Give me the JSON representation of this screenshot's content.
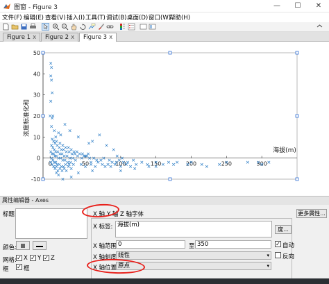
{
  "window": {
    "title": "图窗 - Figure 3",
    "minimize_glyph": "—",
    "maximize_glyph": "☐",
    "close_glyph": "✕"
  },
  "menu": [
    "文件(F)",
    "编辑(E)",
    "查看(V)",
    "插入(I)",
    "工具(T)",
    "调试(B)",
    "桌面(D)",
    "窗口(W)",
    "帮助(H)"
  ],
  "toolbar_icons": [
    "new-file-icon",
    "open-folder-icon",
    "save-icon",
    "print-icon",
    "arrow-cursor-icon",
    "zoom-in-icon",
    "zoom-out-icon",
    "pan-hand-icon",
    "rotate-icon",
    "data-cursor-icon",
    "brush-icon",
    "link-icon",
    "colorbar-icon",
    "legend-icon",
    "hide-plot-tools-icon",
    "show-plot-tools-icon",
    "dock-icon"
  ],
  "tabs": [
    {
      "label": "Figure 1",
      "active": false
    },
    {
      "label": "Figure 2",
      "active": false
    },
    {
      "label": "Figure 3",
      "active": true
    }
  ],
  "tab_close": "x",
  "chart_data": {
    "type": "scatter",
    "marker": "x",
    "color": "#2f7fc7",
    "xlabel": "海拔(m)",
    "ylabel": "浓度标准化和",
    "xlim": [
      -10,
      350
    ],
    "ylim": [
      -10,
      50
    ],
    "yaxis_location": "left",
    "xaxis_location": "origin",
    "xticks": [
      0,
      50,
      100,
      150,
      200,
      250,
      300
    ],
    "yticks": [
      -10,
      0,
      10,
      20,
      30,
      40,
      50
    ],
    "grid": false,
    "points": [
      [
        1,
        45
      ],
      [
        2,
        43
      ],
      [
        1,
        39
      ],
      [
        2,
        37
      ],
      [
        3,
        31
      ],
      [
        1,
        27
      ],
      [
        0,
        20
      ],
      [
        4,
        20
      ],
      [
        3,
        19
      ],
      [
        2,
        15
      ],
      [
        21,
        16
      ],
      [
        28,
        13
      ],
      [
        70,
        11
      ],
      [
        6,
        13
      ],
      [
        12,
        12
      ],
      [
        15,
        11
      ],
      [
        8,
        10
      ],
      [
        40,
        10
      ],
      [
        60,
        8
      ],
      [
        55,
        7
      ],
      [
        80,
        6
      ],
      [
        90,
        4
      ],
      [
        9,
        8
      ],
      [
        14,
        7
      ],
      [
        18,
        6
      ],
      [
        22,
        5
      ],
      [
        26,
        5
      ],
      [
        30,
        4
      ],
      [
        34,
        3
      ],
      [
        38,
        3
      ],
      [
        42,
        2
      ],
      [
        46,
        2
      ],
      [
        48,
        1
      ],
      [
        52,
        1
      ],
      [
        56,
        0
      ],
      [
        62,
        0
      ],
      [
        66,
        -1
      ],
      [
        72,
        -1
      ],
      [
        76,
        0
      ],
      [
        84,
        -1
      ],
      [
        88,
        -2
      ],
      [
        94,
        -2
      ],
      [
        98,
        -1
      ],
      [
        104,
        -2
      ],
      [
        110,
        -2
      ],
      [
        118,
        -1
      ],
      [
        3,
        9
      ],
      [
        5,
        8
      ],
      [
        7,
        7
      ],
      [
        10,
        6
      ],
      [
        13,
        5
      ],
      [
        16,
        4
      ],
      [
        19,
        4
      ],
      [
        23,
        3
      ],
      [
        27,
        3
      ],
      [
        31,
        2
      ],
      [
        35,
        2
      ],
      [
        39,
        1
      ],
      [
        2,
        6
      ],
      [
        4,
        5
      ],
      [
        6,
        4
      ],
      [
        8,
        3
      ],
      [
        11,
        3
      ],
      [
        14,
        2
      ],
      [
        17,
        2
      ],
      [
        20,
        1
      ],
      [
        24,
        1
      ],
      [
        28,
        0
      ],
      [
        32,
        0
      ],
      [
        36,
        -1
      ],
      [
        1,
        3
      ],
      [
        3,
        2
      ],
      [
        5,
        2
      ],
      [
        7,
        1
      ],
      [
        9,
        1
      ],
      [
        12,
        0
      ],
      [
        15,
        0
      ],
      [
        18,
        -1
      ],
      [
        21,
        -1
      ],
      [
        25,
        -2
      ],
      [
        29,
        -2
      ],
      [
        33,
        -3
      ],
      [
        2,
        0
      ],
      [
        4,
        -1
      ],
      [
        6,
        -2
      ],
      [
        8,
        -2
      ],
      [
        10,
        -3
      ],
      [
        13,
        -3
      ],
      [
        16,
        -4
      ],
      [
        19,
        -4
      ],
      [
        22,
        -3
      ],
      [
        26,
        -4
      ],
      [
        30,
        -5
      ],
      [
        1,
        -2
      ],
      [
        3,
        -3
      ],
      [
        5,
        -4
      ],
      [
        7,
        -5
      ],
      [
        9,
        -4
      ],
      [
        11,
        -6
      ],
      [
        14,
        -5
      ],
      [
        17,
        -6
      ],
      [
        20,
        -5
      ],
      [
        23,
        -6
      ],
      [
        27,
        -3
      ],
      [
        44,
        -3
      ],
      [
        50,
        -4
      ],
      [
        58,
        -3
      ],
      [
        64,
        -4
      ],
      [
        68,
        -2
      ],
      [
        74,
        -3
      ],
      [
        78,
        -4
      ],
      [
        82,
        -3
      ],
      [
        86,
        -4
      ],
      [
        92,
        -3
      ],
      [
        100,
        -4
      ],
      [
        108,
        -3
      ],
      [
        114,
        -4
      ],
      [
        122,
        -3
      ],
      [
        130,
        -2
      ],
      [
        138,
        -3
      ],
      [
        140,
        -4
      ],
      [
        150,
        -2
      ],
      [
        160,
        -3
      ],
      [
        168,
        -2
      ],
      [
        175,
        -3
      ],
      [
        180,
        -2
      ],
      [
        195,
        -3
      ],
      [
        200,
        -2
      ],
      [
        215,
        -3
      ],
      [
        222,
        -4
      ],
      [
        250,
        -2
      ],
      [
        280,
        -2
      ],
      [
        300,
        -3
      ],
      [
        310,
        -2
      ],
      [
        295,
        -2
      ],
      [
        240,
        -3
      ],
      [
        150,
        -4
      ],
      [
        120,
        -5
      ],
      [
        100,
        -6
      ],
      [
        60,
        -6
      ],
      [
        40,
        -7
      ],
      [
        12,
        -8
      ],
      [
        30,
        -9
      ],
      [
        18,
        -10
      ],
      [
        9,
        -7
      ],
      [
        45,
        0
      ],
      [
        50,
        1
      ],
      [
        54,
        2
      ],
      [
        58,
        -2
      ],
      [
        95,
        1
      ],
      [
        102,
        0
      ]
    ]
  },
  "property_editor": {
    "header": "属性编辑器 - Axes",
    "title_label": "标题:",
    "title_value": "",
    "color_label": "颜色:",
    "grid_label": "网格:",
    "grid_x": "X",
    "grid_y": "Y",
    "grid_z": "Z",
    "box_label": "框",
    "box_check_label": "框",
    "tabs": [
      "X 轴",
      "Y 轴",
      "Z 轴",
      "字体"
    ],
    "more_props": "更多属性...",
    "x_label_label": "X 标签:",
    "x_label_value": "海拔(m)",
    "degree_button": "度...",
    "x_range_label": "X 轴范围:",
    "x_range_from": "0",
    "x_range_to_label": "至",
    "x_range_to": "350",
    "auto_label": "自动",
    "x_scale_label": "X 轴刻度:",
    "x_scale_value": "线性",
    "reverse_label": "反向",
    "x_location_label": "X 轴位置:",
    "x_location_value": "原点",
    "checkmark": "✓",
    "dropdown_arrow": "▾",
    "highlight_color": "#e8211c"
  }
}
